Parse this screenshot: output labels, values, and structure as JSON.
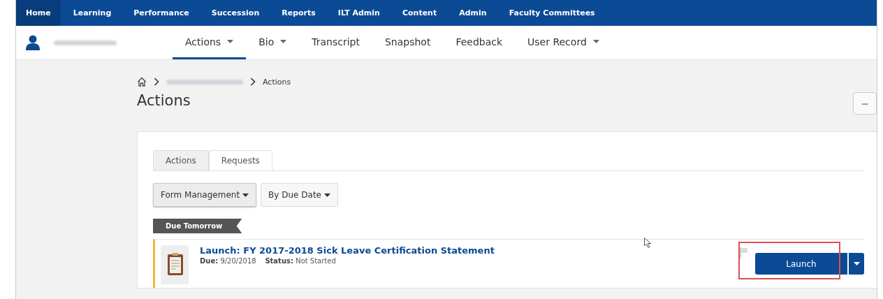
{
  "top_nav": [
    {
      "label": "Home",
      "selected": true
    },
    {
      "label": "Learning",
      "selected": false
    },
    {
      "label": "Performance",
      "selected": false
    },
    {
      "label": "Succession",
      "selected": false
    },
    {
      "label": "Reports",
      "selected": false
    },
    {
      "label": "ILT Admin",
      "selected": false
    },
    {
      "label": "Content",
      "selected": false
    },
    {
      "label": "Admin",
      "selected": false
    },
    {
      "label": "Faculty Committees",
      "selected": false
    }
  ],
  "user": {
    "name_redacted": true
  },
  "sub_nav": [
    {
      "label": "Actions",
      "dropdown": true,
      "selected": true
    },
    {
      "label": "Bio",
      "dropdown": true,
      "selected": false
    },
    {
      "label": "Transcript",
      "dropdown": false,
      "selected": false
    },
    {
      "label": "Snapshot",
      "dropdown": false,
      "selected": false
    },
    {
      "label": "Feedback",
      "dropdown": false,
      "selected": false
    },
    {
      "label": "User Record",
      "dropdown": true,
      "selected": false
    }
  ],
  "breadcrumb": {
    "current": "Actions"
  },
  "page_title": "Actions",
  "more_button": "•••",
  "tabs": [
    {
      "label": "Actions",
      "selected": true
    },
    {
      "label": "Requests",
      "selected": false
    }
  ],
  "filters": [
    {
      "label": "Form Management",
      "active": true
    },
    {
      "label": "By Due Date",
      "active": false
    }
  ],
  "group_label": "Due Tomorrow",
  "items": [
    {
      "title": "Launch: FY 2017-2018 Sick Leave Certification Statement",
      "due_label": "Due:",
      "due": "9/20/2018",
      "status_label": "Status:",
      "status": "Not Started",
      "button": "Launch",
      "highlighted": true
    }
  ]
}
